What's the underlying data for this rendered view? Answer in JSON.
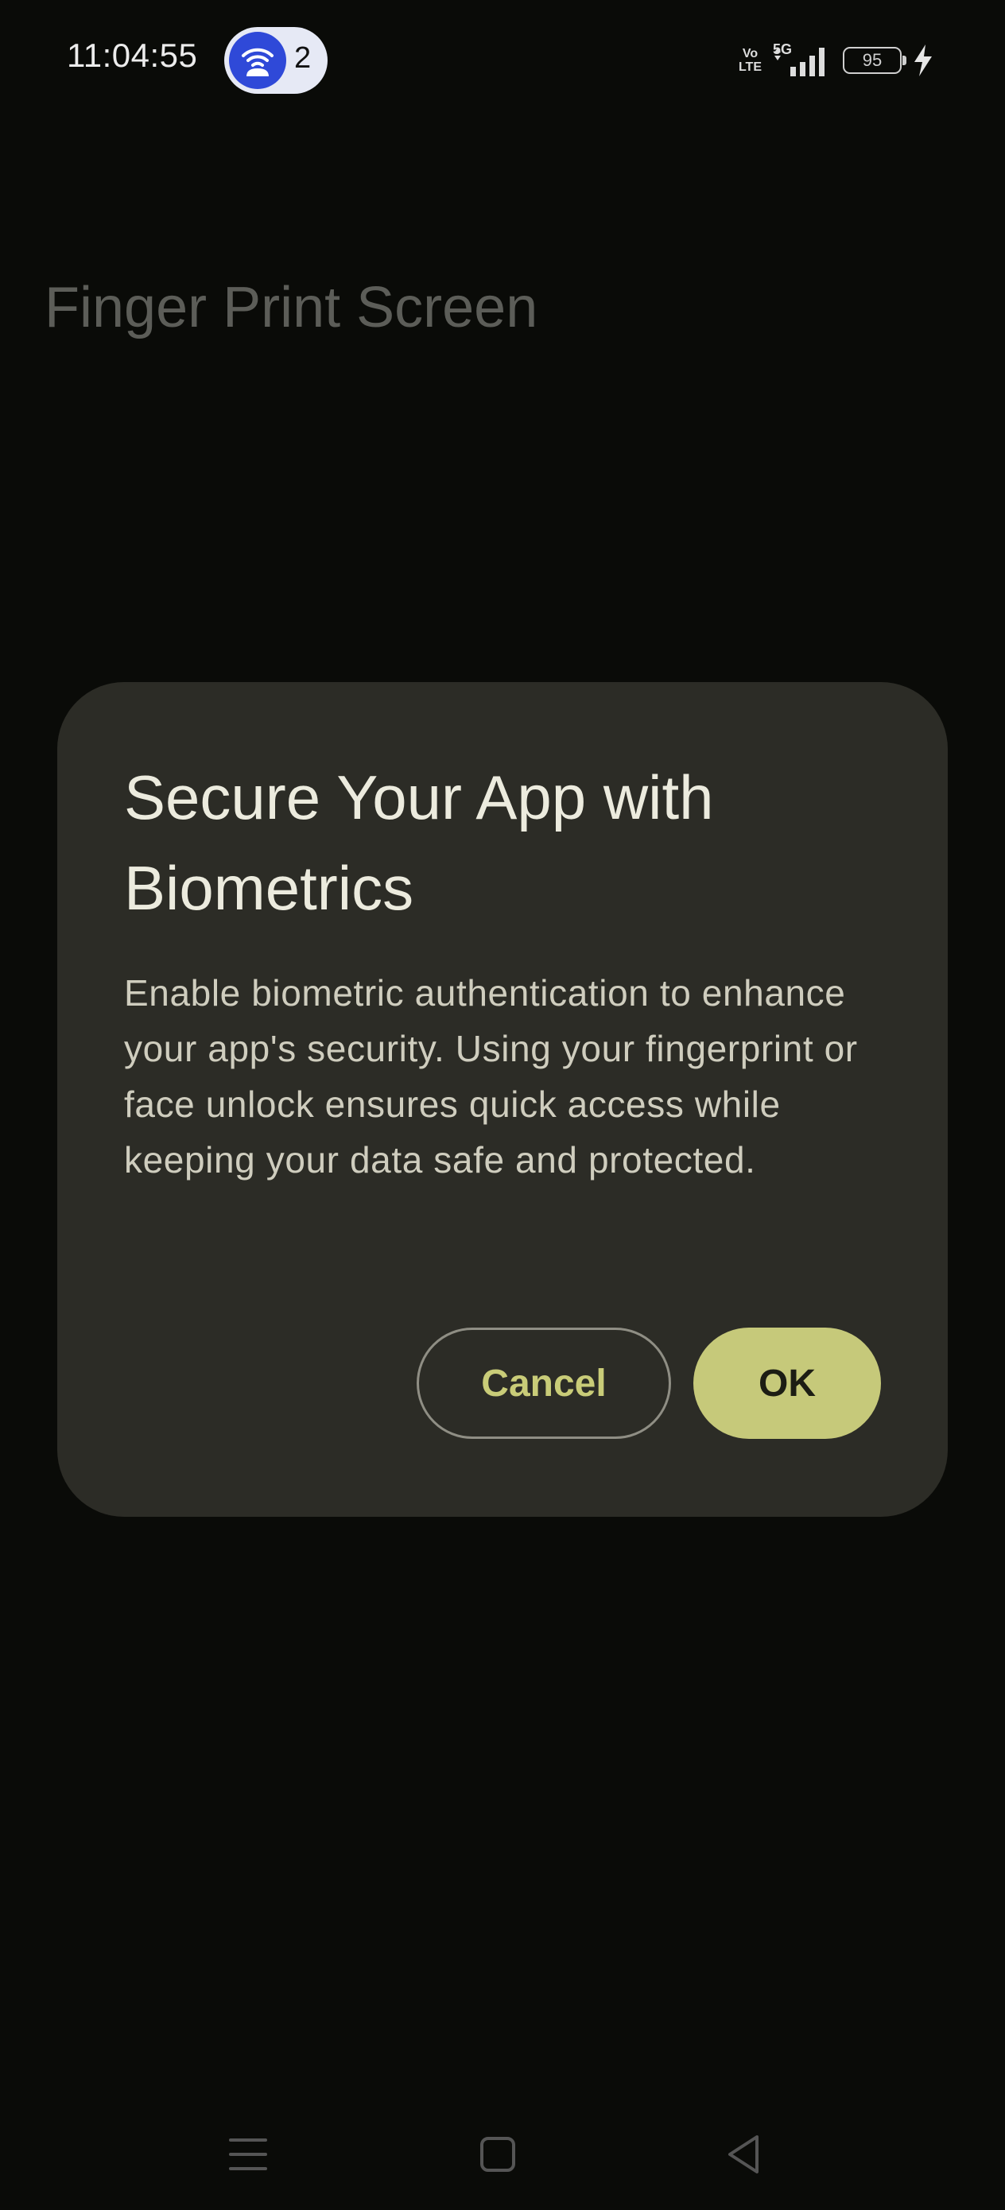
{
  "status_bar": {
    "time": "11:04:55",
    "hotspot_icon": "hotspot-icon",
    "hotspot_count": "2",
    "volte_line1": "Vo",
    "volte_line2": "LTE",
    "network": "5G",
    "battery": "95",
    "charging_icon": "lightning-icon"
  },
  "app": {
    "title": "Finger Print Screen"
  },
  "dialog": {
    "title": "Secure Your App with Biometrics",
    "message": "Enable biometric authentication to enhance your app's security. Using your fingerprint or face unlock ensures quick access while keeping your data safe and protected.",
    "cancel_label": "Cancel",
    "ok_label": "OK"
  },
  "nav_bar": {
    "menu_icon": "menu-icon",
    "home_icon": "home-icon",
    "back_icon": "back-icon"
  },
  "colors": {
    "background": "#0a0b08",
    "dialog_surface": "#2c2c26",
    "accent": "#c6c97a",
    "hotspot_blue": "#2f49d8"
  }
}
